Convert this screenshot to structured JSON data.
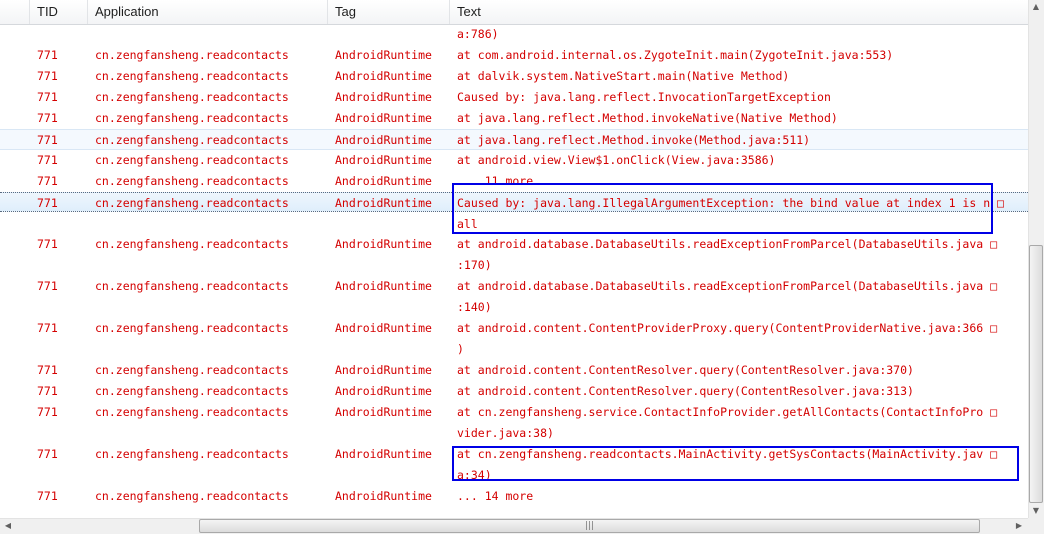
{
  "columns": {
    "c0": "",
    "tid": "TID",
    "application": "Application",
    "tag": "Tag",
    "text": "Text"
  },
  "log_color": "#d40000",
  "highlight_color": "#0000e6",
  "rows": [
    {
      "tid": "",
      "app": "",
      "tag": "",
      "text": "a:786)"
    },
    {
      "tid": "771",
      "app": "cn.zengfansheng.readcontacts",
      "tag": "AndroidRuntime",
      "text": "at com.android.internal.os.ZygoteInit.main(ZygoteInit.java:553)"
    },
    {
      "tid": "771",
      "app": "cn.zengfansheng.readcontacts",
      "tag": "AndroidRuntime",
      "text": "at dalvik.system.NativeStart.main(Native Method)"
    },
    {
      "tid": "771",
      "app": "cn.zengfansheng.readcontacts",
      "tag": "AndroidRuntime",
      "text": "Caused by: java.lang.reflect.InvocationTargetException"
    },
    {
      "tid": "771",
      "app": "cn.zengfansheng.readcontacts",
      "tag": "AndroidRuntime",
      "text": "at java.lang.reflect.Method.invokeNative(Native Method)"
    },
    {
      "tid": "771",
      "app": "cn.zengfansheng.readcontacts",
      "tag": "AndroidRuntime",
      "text": "at java.lang.reflect.Method.invoke(Method.java:511)"
    },
    {
      "tid": "771",
      "app": "cn.zengfansheng.readcontacts",
      "tag": "AndroidRuntime",
      "text": "at android.view.View$1.onClick(View.java:3586)"
    },
    {
      "tid": "771",
      "app": "cn.zengfansheng.readcontacts",
      "tag": "AndroidRuntime",
      "text": "... 11 more"
    },
    {
      "tid": "771",
      "app": "cn.zengfansheng.readcontacts",
      "tag": "AndroidRuntime",
      "text": "Caused by: java.lang.IllegalArgumentException: the bind value at index 1 is n □\nall"
    },
    {
      "tid": "771",
      "app": "cn.zengfansheng.readcontacts",
      "tag": "AndroidRuntime",
      "text": "at android.database.DatabaseUtils.readExceptionFromParcel(DatabaseUtils.java □\n:170)"
    },
    {
      "tid": "771",
      "app": "cn.zengfansheng.readcontacts",
      "tag": "AndroidRuntime",
      "text": "at android.database.DatabaseUtils.readExceptionFromParcel(DatabaseUtils.java □\n:140)"
    },
    {
      "tid": "771",
      "app": "cn.zengfansheng.readcontacts",
      "tag": "AndroidRuntime",
      "text": "at android.content.ContentProviderProxy.query(ContentProviderNative.java:366 □\n)"
    },
    {
      "tid": "771",
      "app": "cn.zengfansheng.readcontacts",
      "tag": "AndroidRuntime",
      "text": "at android.content.ContentResolver.query(ContentResolver.java:370)"
    },
    {
      "tid": "771",
      "app": "cn.zengfansheng.readcontacts",
      "tag": "AndroidRuntime",
      "text": "at android.content.ContentResolver.query(ContentResolver.java:313)"
    },
    {
      "tid": "771",
      "app": "cn.zengfansheng.readcontacts",
      "tag": "AndroidRuntime",
      "text": "at cn.zengfansheng.service.ContactInfoProvider.getAllContacts(ContactInfoPro □\nvider.java:38)"
    },
    {
      "tid": "771",
      "app": "cn.zengfansheng.readcontacts",
      "tag": "AndroidRuntime",
      "text": "at cn.zengfansheng.readcontacts.MainActivity.getSysContacts(MainActivity.jav □\na:34)"
    },
    {
      "tid": "771",
      "app": "cn.zengfansheng.readcontacts",
      "tag": "AndroidRuntime",
      "text": "... 14 more"
    }
  ],
  "scroll": {
    "up": "▲",
    "down": "▼",
    "left": "◀",
    "right": "▶",
    "grip": "|||"
  }
}
